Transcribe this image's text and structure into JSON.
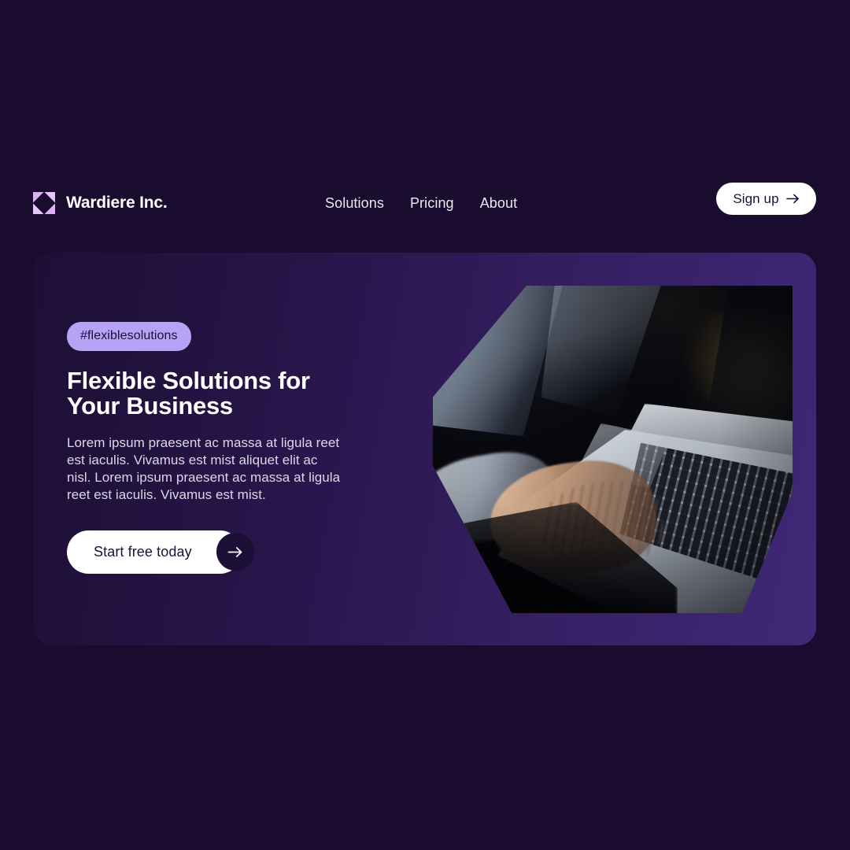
{
  "page": {
    "background_color": "#1a0c2e",
    "card_gradient_from": "#1d0f36",
    "card_gradient_to": "#402878",
    "accent_color": "#b6a3f5",
    "dark_ink": "#1b0f36"
  },
  "header": {
    "brand": {
      "name": "Wardiere Inc.",
      "logo_icon": "double-triangle-logo-icon",
      "logo_color": "#e3b8f7"
    },
    "nav": [
      {
        "label": "Solutions",
        "name": "nav-item-solutions"
      },
      {
        "label": "Pricing",
        "name": "nav-item-pricing"
      },
      {
        "label": "About",
        "name": "nav-item-about"
      }
    ],
    "signup": {
      "label": "Sign up",
      "icon": "arrow-right-icon"
    }
  },
  "hero": {
    "badge": "#flexiblesolutions",
    "headline": "Flexible Solutions for Your Business",
    "body": "Lorem ipsum praesent ac massa at ligula reet est iaculis. Vivamus est mist aliquet elit ac nisl. Lorem ipsum praesent ac massa at ligula reet est iaculis. Vivamus est mist.",
    "cta": {
      "label": "Start free today",
      "icon": "arrow-right-icon"
    },
    "image": {
      "alt": "Person in a suit typing on a silver laptop in low light",
      "shape": "octagon-clipped-photo"
    }
  }
}
